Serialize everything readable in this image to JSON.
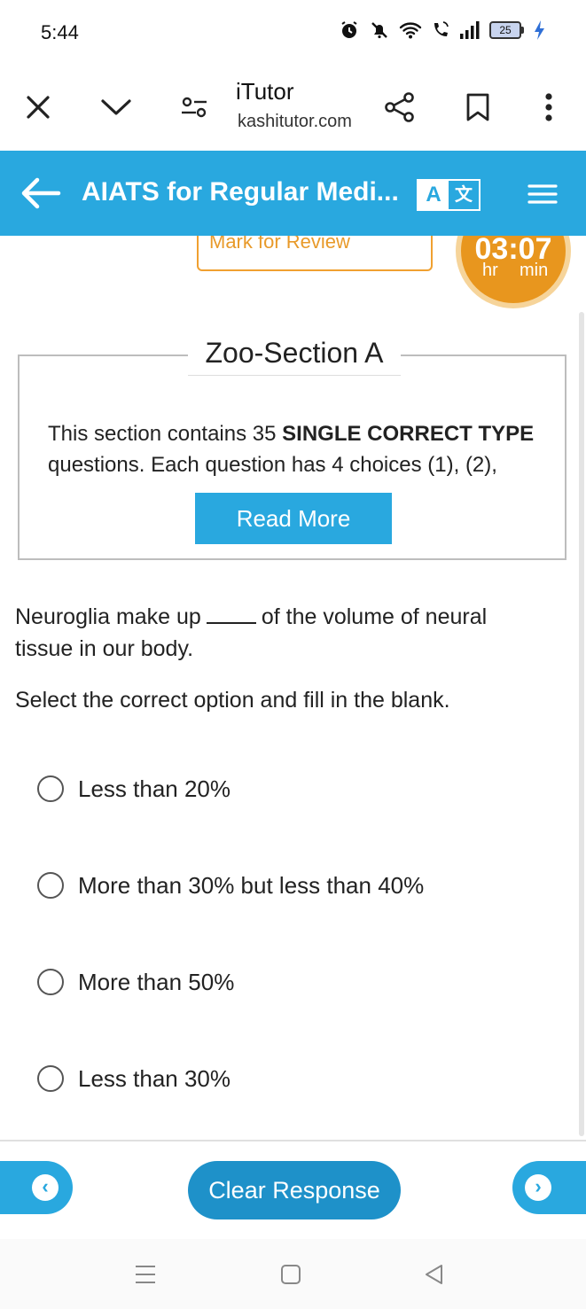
{
  "status_bar": {
    "time": "5:44",
    "battery_level": "25",
    "icons": [
      "alarm-icon",
      "mute-icon",
      "wifi-icon",
      "wifi-call-icon",
      "signal-icon",
      "battery-icon",
      "charging-icon"
    ]
  },
  "browser": {
    "site_title": "iTutor",
    "site_url": "kashitutor.com",
    "icons": [
      "close-icon",
      "chevron-down-icon",
      "settings-icon",
      "share-icon",
      "bookmark-icon",
      "more-icon"
    ]
  },
  "app_header": {
    "title": "AIATS for Regular Medi...",
    "translate_letter": "A",
    "translate_glyph": "文",
    "accent_color": "#29a8df"
  },
  "top_controls": {
    "review_label": "Mark for Review",
    "timer_value": "03:07",
    "timer_hr": "hr",
    "timer_min": "min",
    "timer_color": "#e8961e"
  },
  "section": {
    "title": "Zoo-Section A",
    "desc_prefix": "This section contains 35 ",
    "desc_bold": "SINGLE CORRECT TYPE",
    "desc_suffix": " questions. Each question has 4 choices (1), (2),",
    "read_more": "Read More"
  },
  "question": {
    "text_before": "Neuroglia make up",
    "text_after": "of the volume of neural tissue in our body.",
    "instruction": "Select the correct option and fill in the blank."
  },
  "options": [
    {
      "label": "Less than 20%",
      "selected": false
    },
    {
      "label": "More than 30% but less than 40%",
      "selected": false
    },
    {
      "label": "More than 50%",
      "selected": false
    },
    {
      "label": "Less than 30%",
      "selected": false
    }
  ],
  "actions": {
    "prev_glyph": "‹",
    "next_glyph": "›",
    "clear_label": "Clear Response"
  },
  "system_nav": {
    "icons": [
      "recents-icon",
      "home-icon",
      "back-icon"
    ]
  }
}
